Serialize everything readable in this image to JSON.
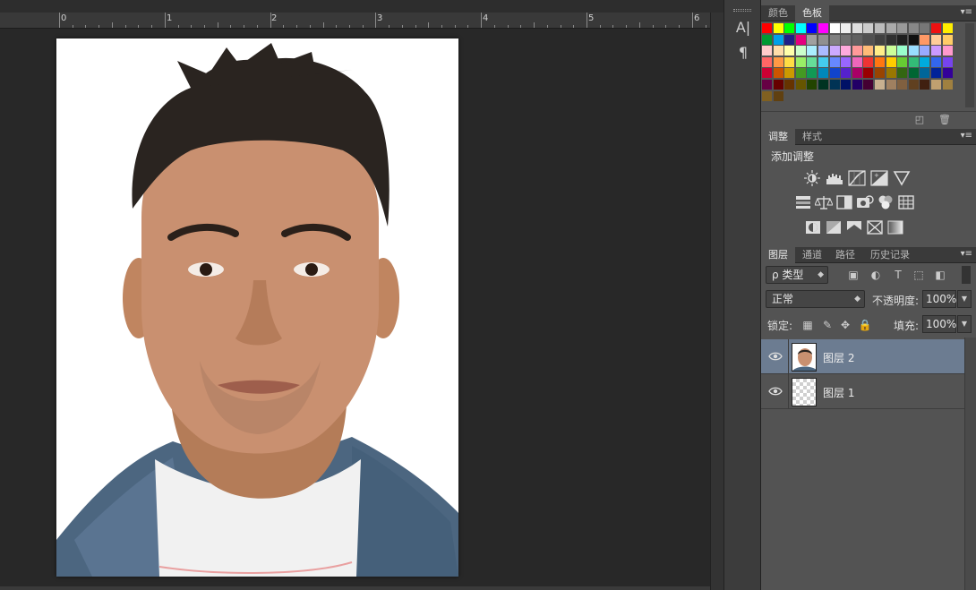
{
  "ruler": {
    "numbers": [
      "0",
      "1",
      "2",
      "3",
      "4",
      "5",
      "6"
    ]
  },
  "tools": {
    "character_icon": "A|",
    "paragraph_icon": "¶"
  },
  "swatches_panel": {
    "tabs": [
      "颜色",
      "色板"
    ],
    "active_tab": "色板",
    "colors": [
      "#ff0000",
      "#ffff00",
      "#00ff00",
      "#00ffff",
      "#0000ff",
      "#ff00ff",
      "#ffffff",
      "#eeeeee",
      "#dddddd",
      "#cccccc",
      "#bbbbbb",
      "#aaaaaa",
      "#999999",
      "#888888",
      "#777777",
      "#ee1111",
      "#ffee00",
      "#009933",
      "#00a0e9",
      "#1d2088",
      "#e4007f",
      "#a0a0a0",
      "#909090",
      "#808080",
      "#707070",
      "#606060",
      "#505050",
      "#404040",
      "#303030",
      "#202020",
      "#101010",
      "#ff9966",
      "#ffcc99",
      "#ffcc66",
      "#ffcccc",
      "#ffddaa",
      "#ffffaa",
      "#ccffcc",
      "#aaeeff",
      "#aabbff",
      "#ccaaff",
      "#ffaadd",
      "#ff9999",
      "#ffbb77",
      "#ffee88",
      "#ccff99",
      "#99ffcc",
      "#99ddff",
      "#99aaff",
      "#cc99ff",
      "#ff99cc",
      "#ff6666",
      "#ff9944",
      "#ffdd44",
      "#99ee66",
      "#66dd99",
      "#44ccee",
      "#6688ff",
      "#9966ff",
      "#ee66bb",
      "#ee3333",
      "#ff7711",
      "#ffcc00",
      "#66cc33",
      "#33bb77",
      "#00aadd",
      "#3366ee",
      "#7744ee",
      "#cc0033",
      "#cc5500",
      "#cc9900",
      "#449922",
      "#119955",
      "#0088bb",
      "#1144cc",
      "#5522cc",
      "#aa0066",
      "#990000",
      "#994400",
      "#997700",
      "#336611",
      "#006633",
      "#006699",
      "#002299",
      "#330099",
      "#660044",
      "#660000",
      "#663300",
      "#665500",
      "#224400",
      "#003322",
      "#003355",
      "#001166",
      "#220066",
      "#440033",
      "#c8b090",
      "#a08060",
      "#806040",
      "#604020",
      "#402010",
      "#c0a070",
      "#a08040",
      "#806020",
      "#604010"
    ]
  },
  "adjustments_panel": {
    "tabs": [
      "调整",
      "样式"
    ],
    "active_tab": "调整",
    "title": "添加调整",
    "icons_row1": [
      "brightness-contrast-icon",
      "levels-icon",
      "curves-icon",
      "exposure-icon",
      "vibrance-icon"
    ],
    "icons_row2": [
      "hue-saturation-icon",
      "color-balance-icon",
      "black-white-icon",
      "photo-filter-icon",
      "channel-mixer-icon",
      "color-lookup-icon"
    ],
    "icons_row3": [
      "invert-icon",
      "posterize-icon",
      "threshold-icon",
      "selective-color-icon",
      "gradient-map-icon"
    ]
  },
  "layers_panel": {
    "tabs": [
      "图层",
      "通道",
      "路径",
      "历史记录"
    ],
    "active_tab": "图层",
    "filter_label": "ρ 类型",
    "blend_mode": "正常",
    "opacity_label": "不透明度:",
    "opacity_value": "100%",
    "lock_label": "锁定:",
    "fill_label": "填充:",
    "fill_value": "100%",
    "layers": [
      {
        "name": "图层 2",
        "selected": true,
        "thumb": "photo"
      },
      {
        "name": "图层 1",
        "selected": false,
        "thumb": "transparent"
      }
    ]
  }
}
